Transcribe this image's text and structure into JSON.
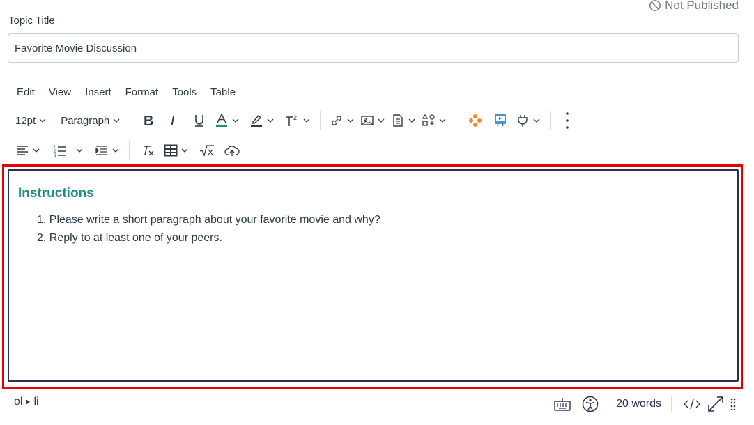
{
  "status": {
    "text": "Not Published"
  },
  "topic": {
    "label": "Topic Title",
    "value": "Favorite Movie Discussion"
  },
  "menu": [
    "Edit",
    "View",
    "Insert",
    "Format",
    "Tools",
    "Table"
  ],
  "toolbar": {
    "font_size": "12pt",
    "block_format": "Paragraph",
    "text_color": "#1e8f7b"
  },
  "editor": {
    "heading": "Instructions",
    "items": [
      "1. Please write a short paragraph about your favorite movie and why?",
      "2. Reply to at least one of your peers."
    ]
  },
  "statusbar": {
    "path_ol": "ol",
    "path_li": "li",
    "word_count": "20 words"
  },
  "colors": {
    "accent": "#1e8f7b",
    "highlight_outline": "#e60000",
    "editor_border": "#2a2f5a",
    "lti_orange": "#f08a24",
    "lti_blue": "#1a7fb8"
  }
}
